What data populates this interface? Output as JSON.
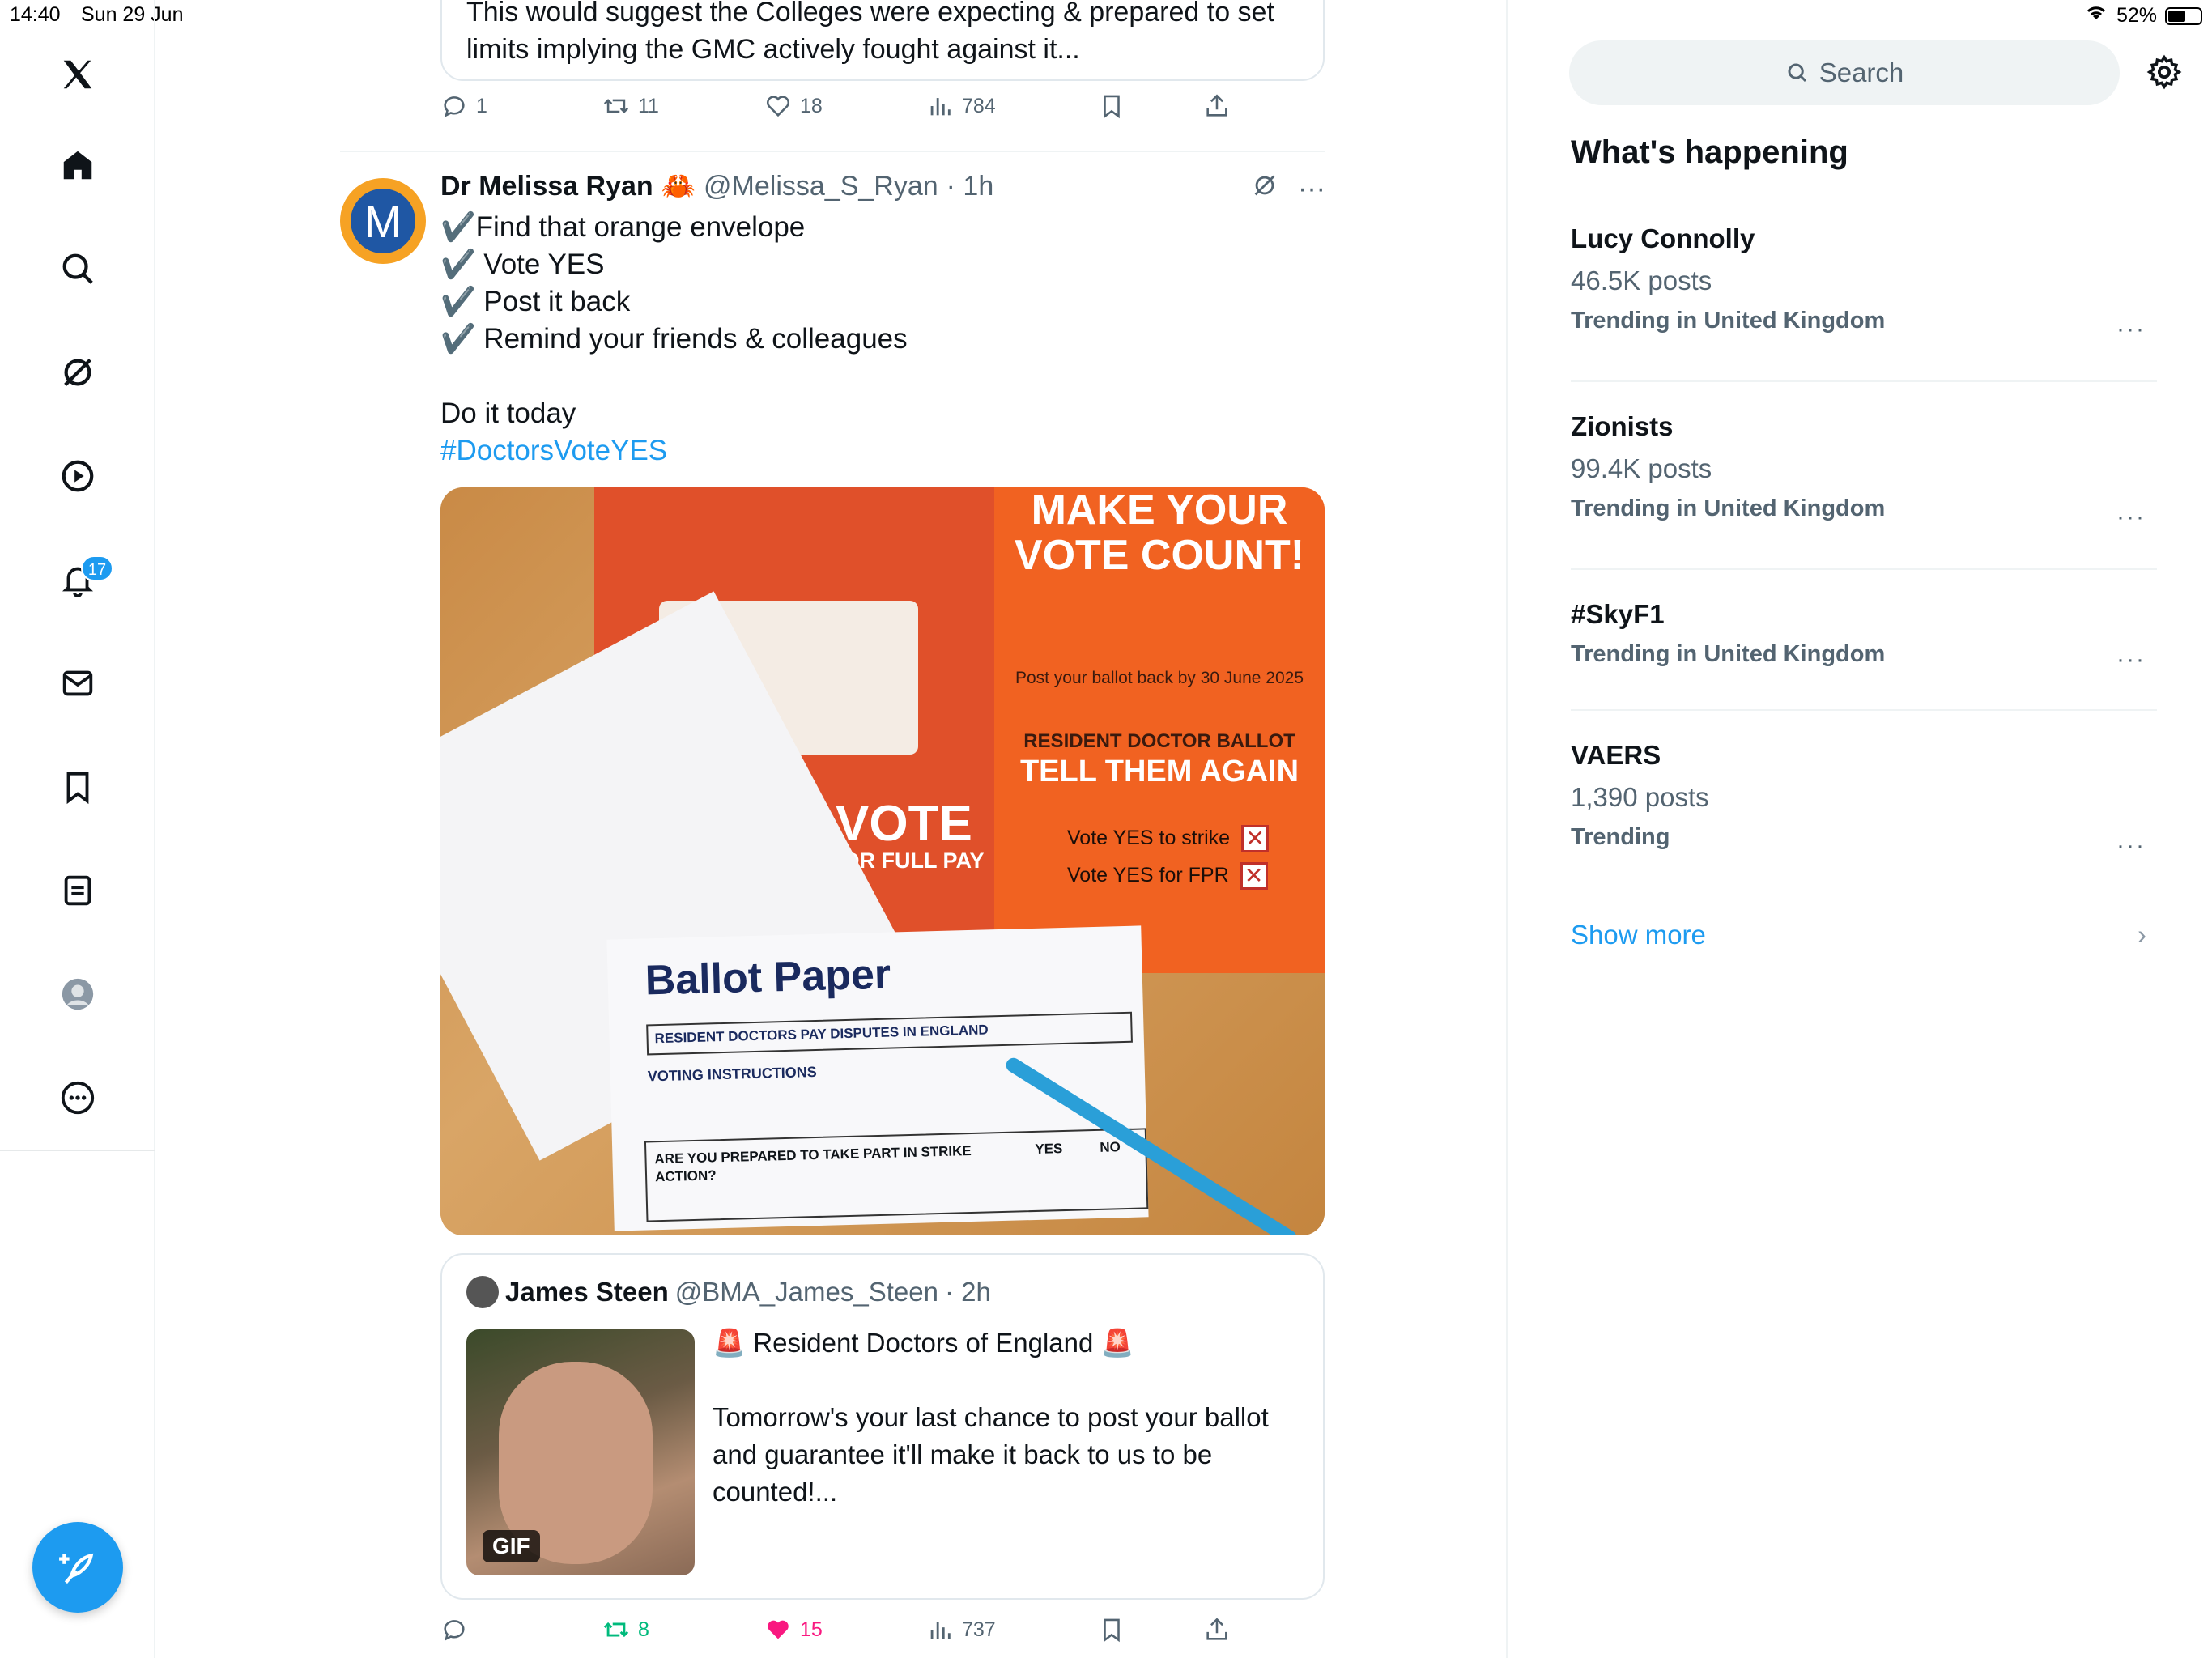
{
  "status": {
    "time": "14:40",
    "date": "Sun 29 Jun",
    "battery": "52%"
  },
  "nav": {
    "notifications_badge": "17"
  },
  "prev_tweet": {
    "text_line1": "This would suggest the Colleges were expecting & prepared to set",
    "text_line2": "limits implying the GMC actively fought against it...",
    "replies": "1",
    "reposts": "11",
    "likes": "18",
    "views": "784"
  },
  "tweet": {
    "avatar_letter": "M",
    "name": "Dr Melissa Ryan",
    "name_emoji": "🦀",
    "handle": "@Melissa_S_Ryan",
    "time": "· 1h",
    "lines": [
      "✔️Find that orange envelope",
      "✔️ Vote YES",
      "✔️ Post it back",
      "✔️ Remind your friends & colleagues",
      "",
      "Do it today"
    ],
    "hashtag": "#DoctorsVoteYES",
    "image": {
      "leaflet_title": "MAKE YOUR VOTE COUNT!",
      "leaflet_post": "Post your ballot back by 30 June 2025",
      "leaflet_sub": "RESIDENT DOCTOR BALLOT",
      "leaflet_again": "TELL THEM AGAIN",
      "leaflet_strike": "Vote YES to strike",
      "leaflet_fpr": "Vote YES for FPR",
      "vote_big": "VOTE",
      "vote_sub": "FOR FULL PAY",
      "ballot_title": "Ballot Paper",
      "ballot_subtitle": "RESIDENT DOCTORS PAY DISPUTES IN ENGLAND",
      "ballot_instr": "VOTING INSTRUCTIONS",
      "ballot_question": "ARE YOU PREPARED TO TAKE PART IN STRIKE ACTION?",
      "ballot_yes": "YES",
      "ballot_no": "NO"
    },
    "quote": {
      "name": "James Steen",
      "handle": "@BMA_James_Steen",
      "time": "· 2h",
      "gif_label": "GIF",
      "text": "🚨 Resident Doctors of England 🚨\n\nTomorrow's your last chance to post your ballot and guarantee it'll make it back to us to be counted!..."
    },
    "reposts": "8",
    "likes": "15",
    "views": "737"
  },
  "sidebar": {
    "search_placeholder": "Search",
    "title": "What's happening",
    "trends": [
      {
        "name": "Lucy Connolly",
        "count": "46.5K posts",
        "location": "Trending in United Kingdom"
      },
      {
        "name": "Zionists",
        "count": "99.4K posts",
        "location": "Trending in United Kingdom"
      },
      {
        "name": "#SkyF1",
        "count": "",
        "location": "Trending in United Kingdom"
      },
      {
        "name": "VAERS",
        "count": "1,390 posts",
        "location": "Trending"
      }
    ],
    "show_more": "Show more"
  }
}
